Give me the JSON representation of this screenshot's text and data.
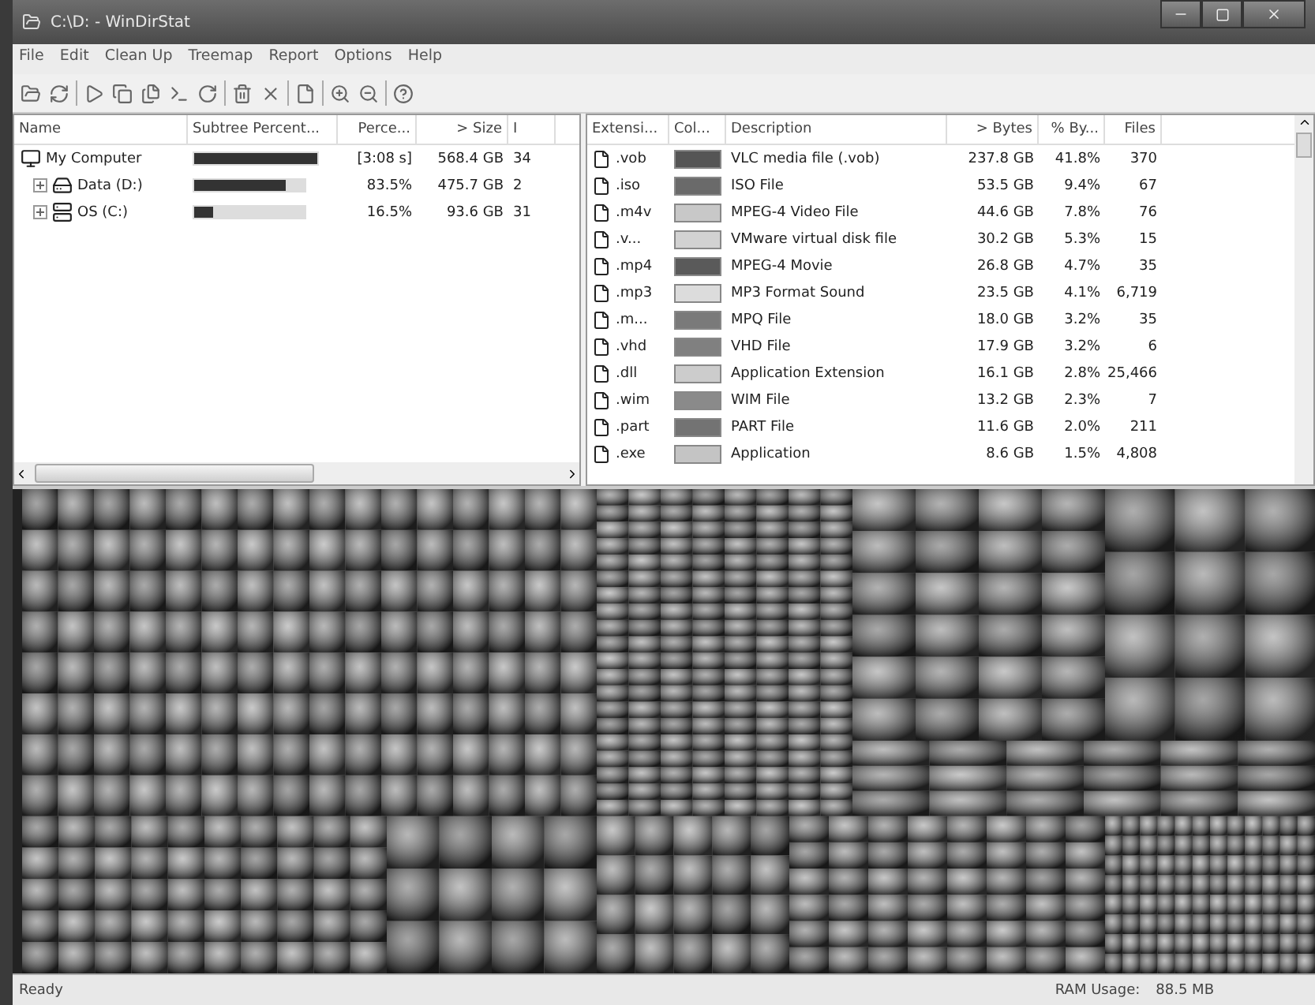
{
  "window": {
    "title": "C:\\D: - WinDirStat"
  },
  "menu": [
    "File",
    "Edit",
    "Clean Up",
    "Treemap",
    "Report",
    "Options",
    "Help"
  ],
  "directory_list": {
    "columns": [
      "Name",
      "Subtree Percent...",
      "Perce...",
      "> Size",
      "I"
    ],
    "rows": [
      {
        "name": "My Computer",
        "kind": "computer",
        "level": 1,
        "percent": "[3:08 s]",
        "size": "568.4 GB",
        "column_5": "34",
        "children": [
          {
            "name": "Data (D:)",
            "kind": "drive",
            "level": 0.835,
            "percent": "83.5%",
            "size": "475.7 GB",
            "column_5": "2",
            "expanded": false
          },
          {
            "name": "OS (C:)",
            "kind": "system-drive",
            "level": 0.165,
            "percent": "16.5%",
            "size": "93.6 GB",
            "column_5": "31",
            "expanded": false
          }
        ]
      }
    ]
  },
  "extension_list": {
    "columns": [
      "Extensi...",
      "Col...",
      "Description",
      "> Bytes",
      "% By...",
      "Files"
    ],
    "rows": [
      {
        "extension": ".vob",
        "color": "#555555",
        "description": "VLC media file (.vob)",
        "bytes": "237.8 GB",
        "percent": "41.8%",
        "files": "370"
      },
      {
        "extension": ".iso",
        "color": "#6a6a6a",
        "description": "ISO File",
        "bytes": "53.5 GB",
        "percent": "9.4%",
        "files": "67"
      },
      {
        "extension": ".m4v",
        "color": "#c8c8c8",
        "description": "MPEG-4 Video File",
        "bytes": "44.6 GB",
        "percent": "7.8%",
        "files": "76"
      },
      {
        "extension": ".v...",
        "color": "#d2d2d2",
        "description": "VMware virtual disk file",
        "bytes": "30.2 GB",
        "percent": "5.3%",
        "files": "15"
      },
      {
        "extension": ".mp4",
        "color": "#5a5a5a",
        "description": "MPEG-4 Movie",
        "bytes": "26.8 GB",
        "percent": "4.7%",
        "files": "35"
      },
      {
        "extension": ".mp3",
        "color": "#dcdcdc",
        "description": "MP3 Format Sound",
        "bytes": "23.5 GB",
        "percent": "4.1%",
        "files": "6,719"
      },
      {
        "extension": ".m...",
        "color": "#7a7a7a",
        "description": "MPQ File",
        "bytes": "18.0 GB",
        "percent": "3.2%",
        "files": "35"
      },
      {
        "extension": ".vhd",
        "color": "#808080",
        "description": "VHD File",
        "bytes": "17.9 GB",
        "percent": "3.2%",
        "files": "6"
      },
      {
        "extension": ".dll",
        "color": "#cccccc",
        "description": "Application Extension",
        "bytes": "16.1 GB",
        "percent": "2.8%",
        "files": "25,466"
      },
      {
        "extension": ".wim",
        "color": "#8a8a8a",
        "description": "WIM File",
        "bytes": "13.2 GB",
        "percent": "2.3%",
        "files": "7"
      },
      {
        "extension": ".part",
        "color": "#737373",
        "description": "PART File",
        "bytes": "11.6 GB",
        "percent": "2.0%",
        "files": "211"
      },
      {
        "extension": ".exe",
        "color": "#c4c4c4",
        "description": "Application",
        "bytes": "8.6 GB",
        "percent": "1.5%",
        "files": "4,808"
      }
    ]
  },
  "status_bar": {
    "message": "Ready",
    "memory_label": "RAM Usage:",
    "memory_value": "88.5 MB"
  }
}
